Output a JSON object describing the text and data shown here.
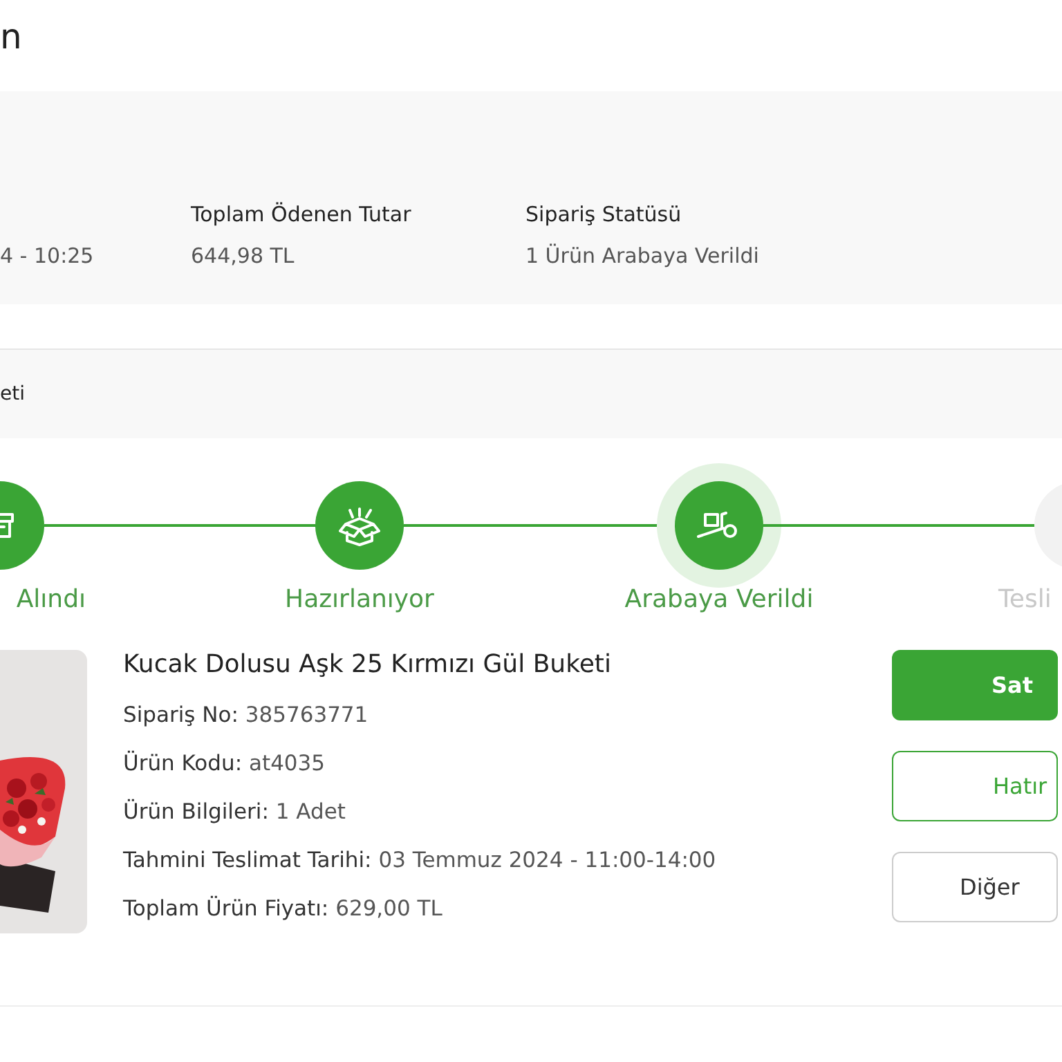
{
  "page_title": "n",
  "summary": [
    {
      "value": "4 - 10:25"
    },
    {
      "label": "Toplam Ödenen Tutar",
      "value": "644,98 TL"
    },
    {
      "label": "Sipariş Statüsü",
      "value": "1 Ürün Arabaya Verildi"
    }
  ],
  "section_bar": {
    "text": "eti"
  },
  "steps": [
    {
      "label": "Alındı",
      "completed": true,
      "selected": false
    },
    {
      "label": "Hazırlanıyor",
      "completed": true,
      "selected": false
    },
    {
      "label": "Arabaya Verildi",
      "completed": true,
      "selected": true
    },
    {
      "label": "Tesli",
      "completed": false,
      "selected": false
    }
  ],
  "product": {
    "title": "Kucak Dolusu Aşk 25 Kırmızı Gül Buketi",
    "details": [
      {
        "label": "Sipariş No:",
        "value": "385763771"
      },
      {
        "label": "Ürün Kodu:",
        "value": "at4035"
      },
      {
        "label": "Ürün Bilgileri:",
        "value": "1 Adet"
      },
      {
        "label": "Tahmini Teslimat Tarihi:",
        "value": "03 Temmuz 2024 - 11:00-14:00"
      },
      {
        "label": "Toplam Ürün Fiyatı:",
        "value": "629,00 TL"
      }
    ]
  },
  "buttons": [
    {
      "label": "Sat",
      "kind": "primary"
    },
    {
      "label": "Hatır",
      "kind": "outline"
    },
    {
      "label": "Diğer",
      "kind": "secondary"
    }
  ]
}
